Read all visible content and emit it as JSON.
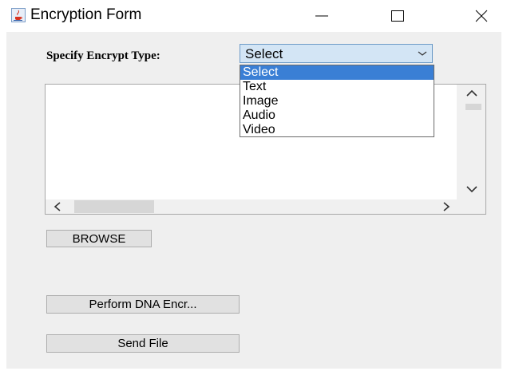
{
  "window": {
    "title": "Encryption Form",
    "icon": "java-cup-icon",
    "controls": [
      "minimize-icon",
      "maximize-icon",
      "close-icon"
    ]
  },
  "form": {
    "encrypt_label": "Specify Encrypt Type:",
    "combo_value": "Select",
    "combo_options": [
      "Select",
      "Text",
      "Image",
      "Audio",
      "Video"
    ],
    "selected_index": 0,
    "textarea_value": "",
    "browse_label": "BROWSE",
    "perform_label": "Perform DNA Encr...",
    "send_label": "Send File"
  },
  "colors": {
    "combo_bg": "#d3e5f5",
    "selected_item": "#3a7fd5",
    "client_bg": "#efefef"
  }
}
